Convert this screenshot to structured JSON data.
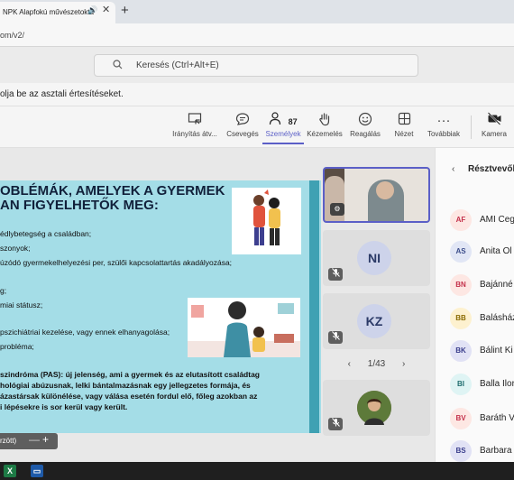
{
  "browser": {
    "tab_title": "NPK Alapfokú művészetokta",
    "audio_icon": "speaker-icon",
    "close_label": "✕",
    "new_tab_label": "+",
    "url": "om/v2/"
  },
  "teams": {
    "search_placeholder": "Keresés (Ctrl+Alt+E)",
    "notification": "olja be az asztali értesítéseket."
  },
  "toolbar": {
    "items": [
      {
        "label": "Irányítás átv...",
        "icon": "share-control-icon"
      },
      {
        "label": "Csevegés",
        "icon": "chat-icon"
      },
      {
        "label": "Személyek",
        "icon": "people-icon",
        "count": "87"
      },
      {
        "label": "Kézemelés",
        "icon": "raise-hand-icon"
      },
      {
        "label": "Reagálás",
        "icon": "emoji-icon"
      },
      {
        "label": "Nézet",
        "icon": "grid-view-icon"
      },
      {
        "label": "Továbbiak",
        "icon": "more-icon"
      },
      {
        "label": "Kamera",
        "icon": "camera-off-icon"
      }
    ]
  },
  "slide": {
    "title_line1": "OBLÉMÁK, AMELYEK A GYERMEK",
    "title_line2": "AN FIGYELHETŐK MEG:",
    "lines": [
      "édlybetegség a családban;",
      "szonyok;",
      "úzódó gyermekelhelyezési per, szülői kapcsolattartás akadályozása;",
      "g;",
      "miai státusz;",
      "pszichiátriai kezelése, vagy ennek elhanyagolása;",
      " probléma;"
    ],
    "bold_lines": [
      "szindróma (PAS): új jelenség, ami a gyermek és az elutasított családtag",
      "hológiai abúzusnak, lelki bántalmazásnak egy jellegzetes formája, és",
      "ázastársak különélése, vagy válása esetén fordul elő, főleg azokban az",
      "i lépésekre is sor kerül vagy került."
    ]
  },
  "zoom": {
    "label": "rzött)",
    "minus": "—",
    "plus": "+"
  },
  "tiles": [
    {
      "initials": "",
      "muted": false
    },
    {
      "initials": "NI",
      "muted": true
    },
    {
      "initials": "KZ",
      "muted": true
    },
    {
      "initials": "",
      "muted": true
    }
  ],
  "pager": {
    "prev": "‹",
    "text": "1/43",
    "next": "›"
  },
  "participants": {
    "title": "Résztvevők",
    "back": "‹",
    "list": [
      {
        "initials": "AF",
        "name": "AMI Ceg",
        "bg": "#fde7e3",
        "fg": "#c4314b"
      },
      {
        "initials": "AS",
        "name": "Anita Ol",
        "bg": "#e1e6f5",
        "fg": "#3c4d8a"
      },
      {
        "initials": "BN",
        "name": "Bajánné",
        "bg": "#fde7e3",
        "fg": "#c4314b"
      },
      {
        "initials": "BB",
        "name": "Balásház",
        "bg": "#fdf1cf",
        "fg": "#8a6a00"
      },
      {
        "initials": "BK",
        "name": "Bálint Ki",
        "bg": "#e1e2f5",
        "fg": "#3a3e8c"
      },
      {
        "initials": "BI",
        "name": "Balla Ilor",
        "bg": "#dff4f4",
        "fg": "#1f6c6e"
      },
      {
        "initials": "BV",
        "name": "Baráth V",
        "bg": "#fde7e3",
        "fg": "#c4314b"
      },
      {
        "initials": "BS",
        "name": "Barbara",
        "bg": "#e1e2f5",
        "fg": "#3a3e8c"
      }
    ]
  },
  "taskbar": {
    "excel": "X",
    "app2": "▭"
  }
}
